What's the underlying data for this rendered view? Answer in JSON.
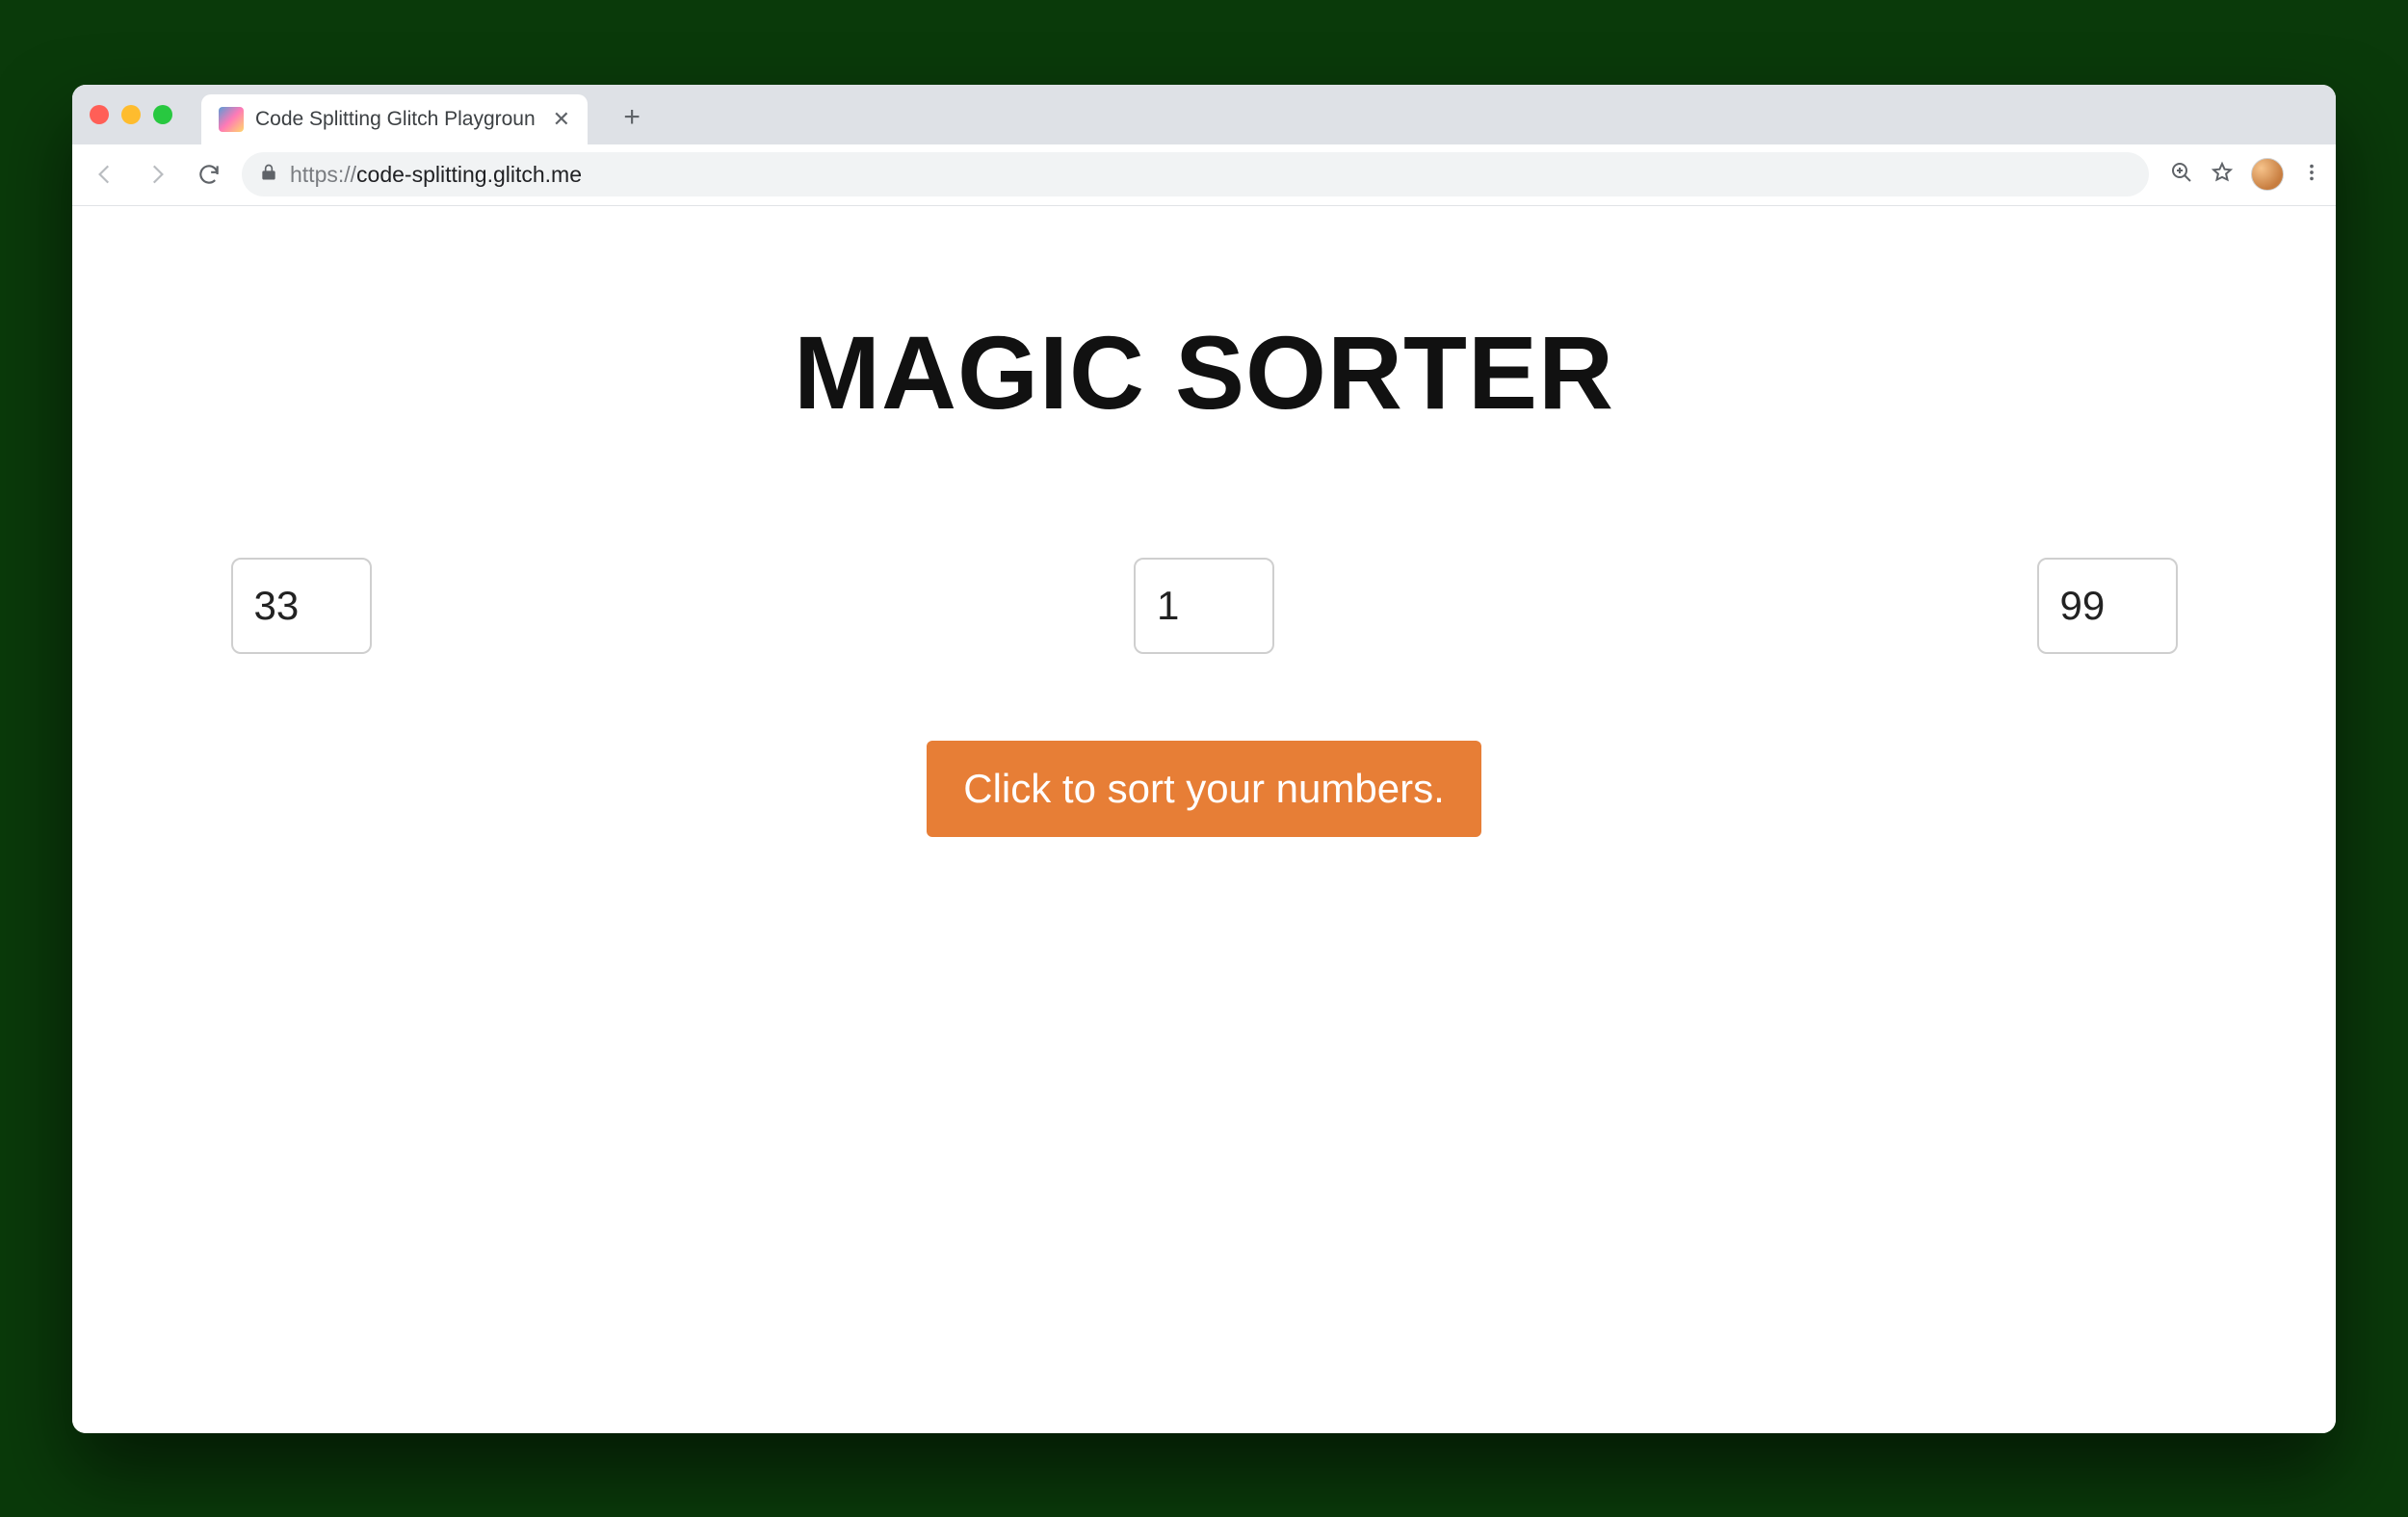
{
  "browser": {
    "tab": {
      "title": "Code Splitting Glitch Playgroun"
    },
    "url_scheme": "https://",
    "url_rest": "code-splitting.glitch.me"
  },
  "page": {
    "heading": "MAGIC SORTER",
    "inputs": {
      "a": "33",
      "b": "1",
      "c": "99"
    },
    "sort_button_label": "Click to sort your numbers."
  },
  "colors": {
    "accent": "#e77e36"
  }
}
